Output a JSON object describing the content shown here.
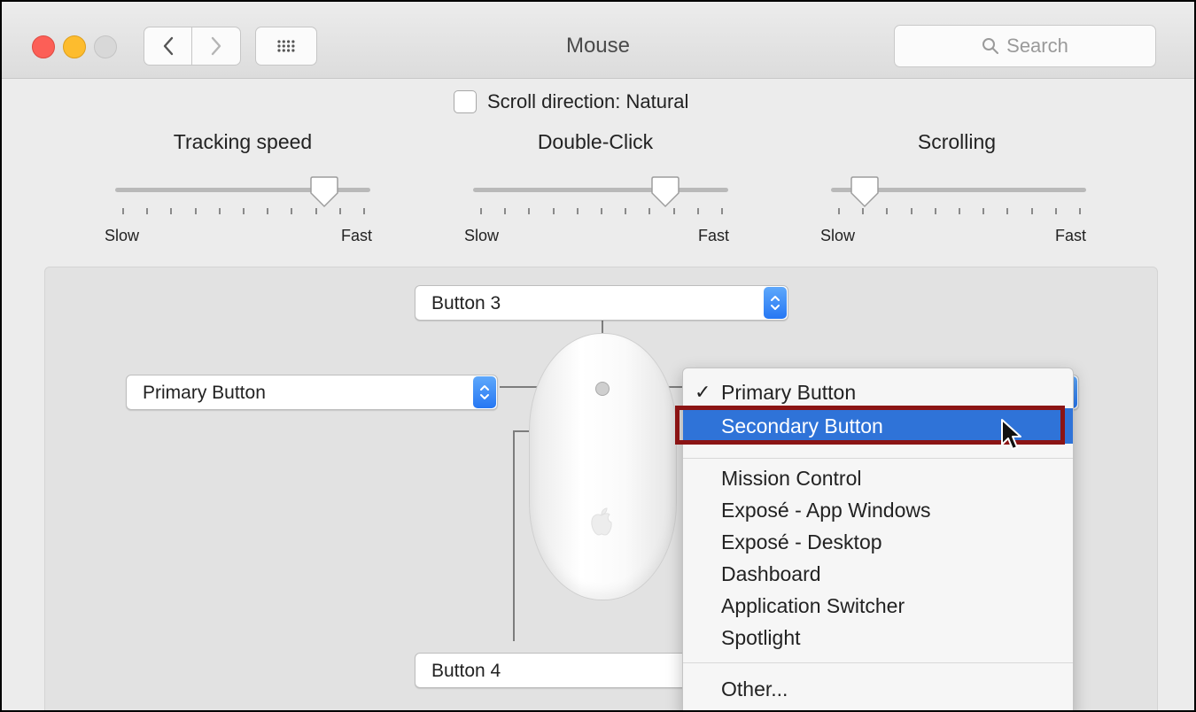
{
  "window": {
    "title": "Mouse"
  },
  "toolbar": {
    "search_placeholder": "Search"
  },
  "scroll_direction": {
    "label": "Scroll direction: Natural",
    "checked": false
  },
  "sliders": [
    {
      "title": "Tracking speed",
      "min_label": "Slow",
      "max_label": "Fast",
      "value": 0.84
    },
    {
      "title": "Double-Click",
      "min_label": "Slow",
      "max_label": "Fast",
      "value": 0.77
    },
    {
      "title": "Scrolling",
      "min_label": "Slow",
      "max_label": "Fast",
      "value": 0.11
    }
  ],
  "buttons": {
    "top": "Button 3",
    "left": "Primary Button",
    "bottom": "Button 4"
  },
  "menu": {
    "items": [
      {
        "label": "Primary Button",
        "checked": true
      },
      {
        "label": "Secondary Button",
        "highlighted": true
      },
      {
        "label": "Mission Control"
      },
      {
        "label": "Exposé - App Windows"
      },
      {
        "label": "Exposé - Desktop"
      },
      {
        "label": "Dashboard"
      },
      {
        "label": "Application Switcher"
      },
      {
        "label": "Spotlight"
      },
      {
        "label": "Other..."
      }
    ],
    "check_glyph": "✓"
  },
  "colors": {
    "accent": "#2f73d8",
    "highlight_box": "#8b1414"
  }
}
